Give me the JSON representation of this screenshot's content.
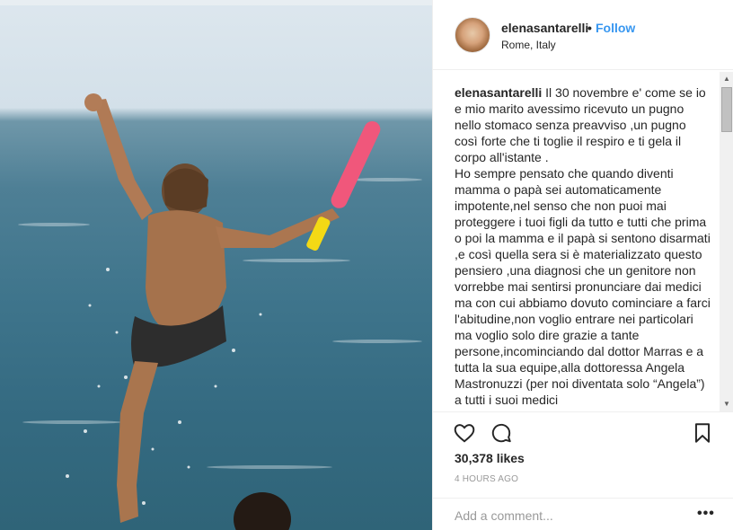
{
  "post": {
    "username": "elenasantarelli",
    "separator": "•",
    "follow_label": "Follow",
    "location": "Rome, Italy",
    "caption_user": "elenasantarelli",
    "caption_text": " Il 30 novembre e' come se io e mio marito avessimo ricevuto un pugno nello stomaco senza preavviso ,un pugno così forte che ti toglie il respiro e ti gela il corpo all'istante .\nHo sempre pensato che quando diventi mamma o papà sei automaticamente impotente,nel senso che non puoi mai proteggere i tuoi figli da tutto e tutti che prima o poi la mamma e il papà si sentono disarmati ,e così quella sera si è materializzato questo pensiero ,una diagnosi che un genitore non vorrebbe mai sentirsi pronunciare dai medici ma con cui abbiamo dovuto cominciare a farci l'abitudine,non voglio entrare nei particolari ma voglio solo dire grazie a tante persone,incominciando dal dottor Marras e a tutta la sua equipe,alla dottoressa Angela Mastronuzzi (per noi diventata solo “Angela”) a tutti i suoi medici",
    "likes": "30,378 likes",
    "time": "4 HOURS AGO",
    "comment_placeholder": "Add a comment...",
    "more_label": "•••"
  },
  "icons": {
    "like": "heart-icon",
    "comment": "comment-bubble-icon",
    "save": "bookmark-icon",
    "more": "more-options-icon"
  },
  "colors": {
    "accent": "#3897f0",
    "text": "#262626",
    "muted": "#999999",
    "border": "#efefef"
  }
}
